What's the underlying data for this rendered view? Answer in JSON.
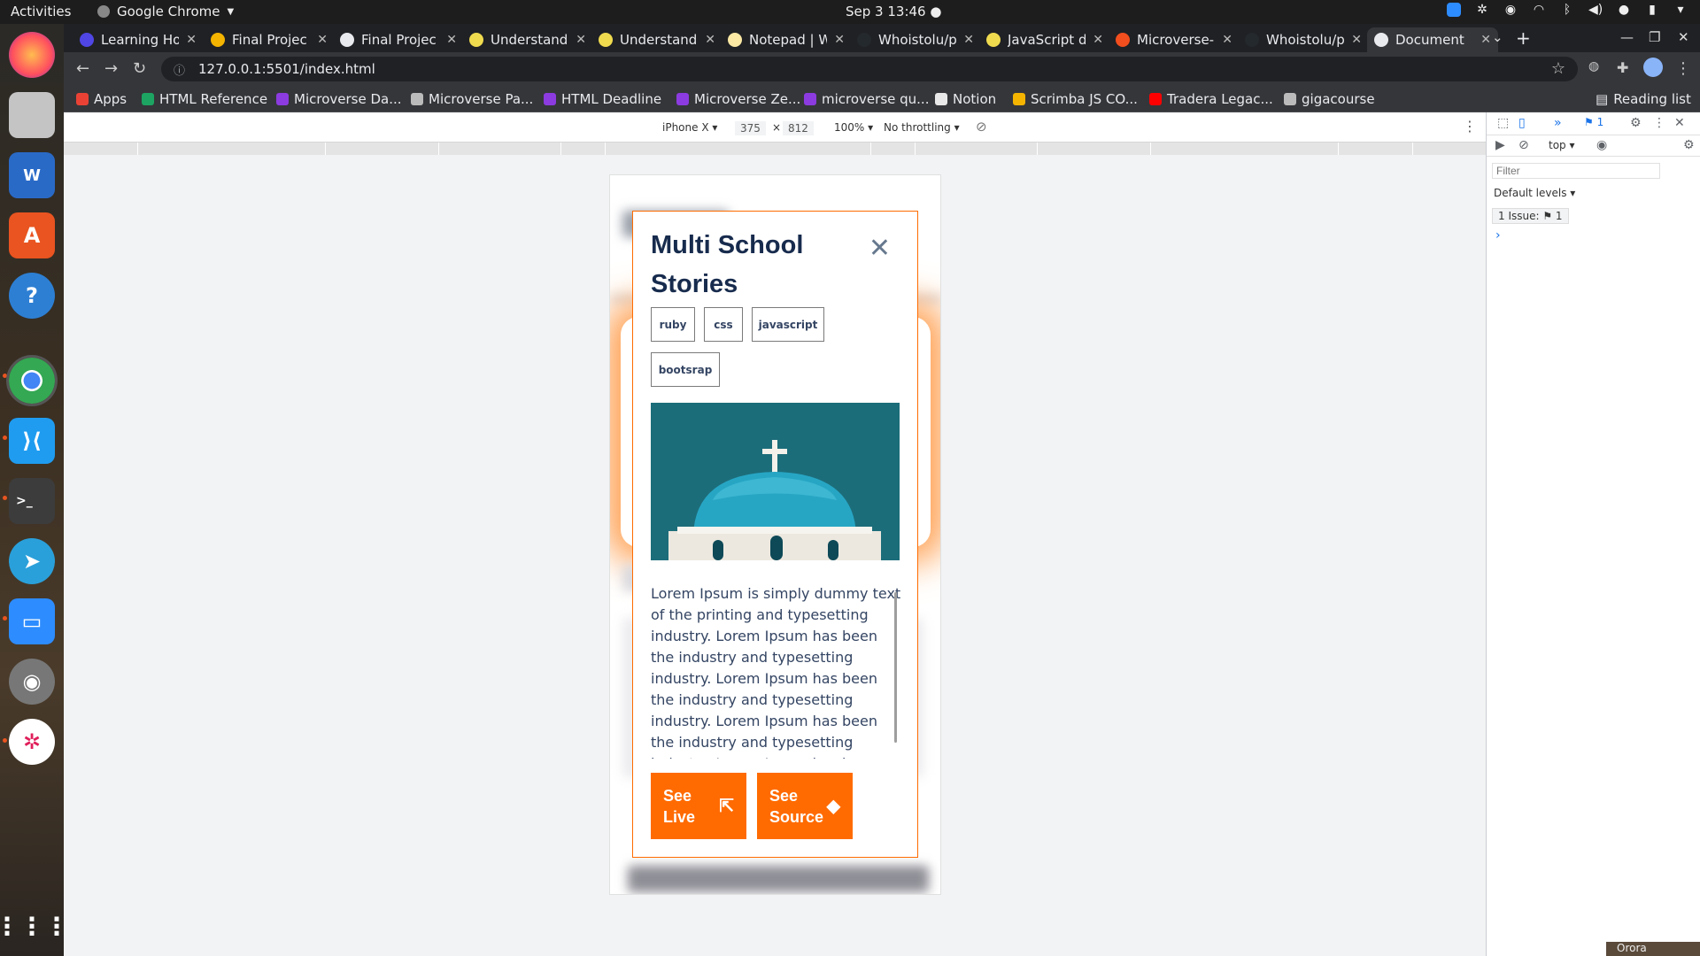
{
  "topbar": {
    "activities": "Activities",
    "app_name": "Google Chrome",
    "clock": "Sep 3  13:46"
  },
  "tabs": [
    {
      "title": "Learning Ho",
      "favicon_color": "#4f46e5"
    },
    {
      "title": "Final Projec",
      "favicon_color": "#f4b400"
    },
    {
      "title": "Final Projec",
      "favicon_color": "#e8eaed"
    },
    {
      "title": "Understand",
      "favicon_color": "#f0db4f"
    },
    {
      "title": "Understand",
      "favicon_color": "#f0db4f"
    },
    {
      "title": "Notepad | W",
      "favicon_color": "#fbe9a4"
    },
    {
      "title": "Whoistolu/p",
      "favicon_color": "#24292e"
    },
    {
      "title": "JavaScript d",
      "favicon_color": "#f0db4f"
    },
    {
      "title": "Microverse-",
      "favicon_color": "#f24e1e"
    },
    {
      "title": "Whoistolu/p",
      "favicon_color": "#24292e"
    },
    {
      "title": "Document",
      "favicon_color": "#e8eaed",
      "active": true
    }
  ],
  "address": {
    "url": "127.0.0.1:5501/index.html"
  },
  "bookmarks": [
    {
      "label": "Apps",
      "color": "#e94235"
    },
    {
      "label": "HTML Reference",
      "color": "#1da462"
    },
    {
      "label": "Microverse Da...",
      "color": "#8c3be0"
    },
    {
      "label": "Microverse Pa...",
      "color": "#bbbbbb"
    },
    {
      "label": "HTML Deadline",
      "color": "#8c3be0"
    },
    {
      "label": "Microverse Ze...",
      "color": "#8c3be0"
    },
    {
      "label": "microverse qu...",
      "color": "#8c3be0"
    },
    {
      "label": "Notion",
      "color": "#e8e8e8"
    },
    {
      "label": "Scrimba JS CO...",
      "color": "#f4b400"
    },
    {
      "label": "Tradera Legac...",
      "color": "#ff0000"
    },
    {
      "label": "gigacourse",
      "color": "#bbbbbb"
    }
  ],
  "reading_list": "Reading list",
  "device_toolbar": {
    "device": "iPhone X ▾",
    "width": "375",
    "height": "812",
    "zoom": "100% ▾",
    "throttle": "No throttling ▾"
  },
  "modal": {
    "title": "Multi School Stories",
    "tags": [
      "ruby",
      "css",
      "javascript",
      "bootsrap"
    ],
    "description": "Lorem Ipsum is simply dummy text of the printing and typesetting industry. Lorem Ipsum has been the industry and typesetting industry. Lorem Ipsum has been the industry and typesetting industry. Lorem Ipsum has been the industry and typesetting industry. Lorem Ipsum has been the industry and typesetting industry.",
    "see_live": "See Live",
    "see_source": "See Source",
    "accent": "#ff6b00",
    "title_color": "#172b4d"
  },
  "devtools": {
    "context": "top ▾",
    "filter_placeholder": "Filter",
    "levels": "Default levels ▾",
    "issues": "1 Issue: ⚑ 1",
    "issues_count": "1"
  },
  "corner_label": "Orora"
}
